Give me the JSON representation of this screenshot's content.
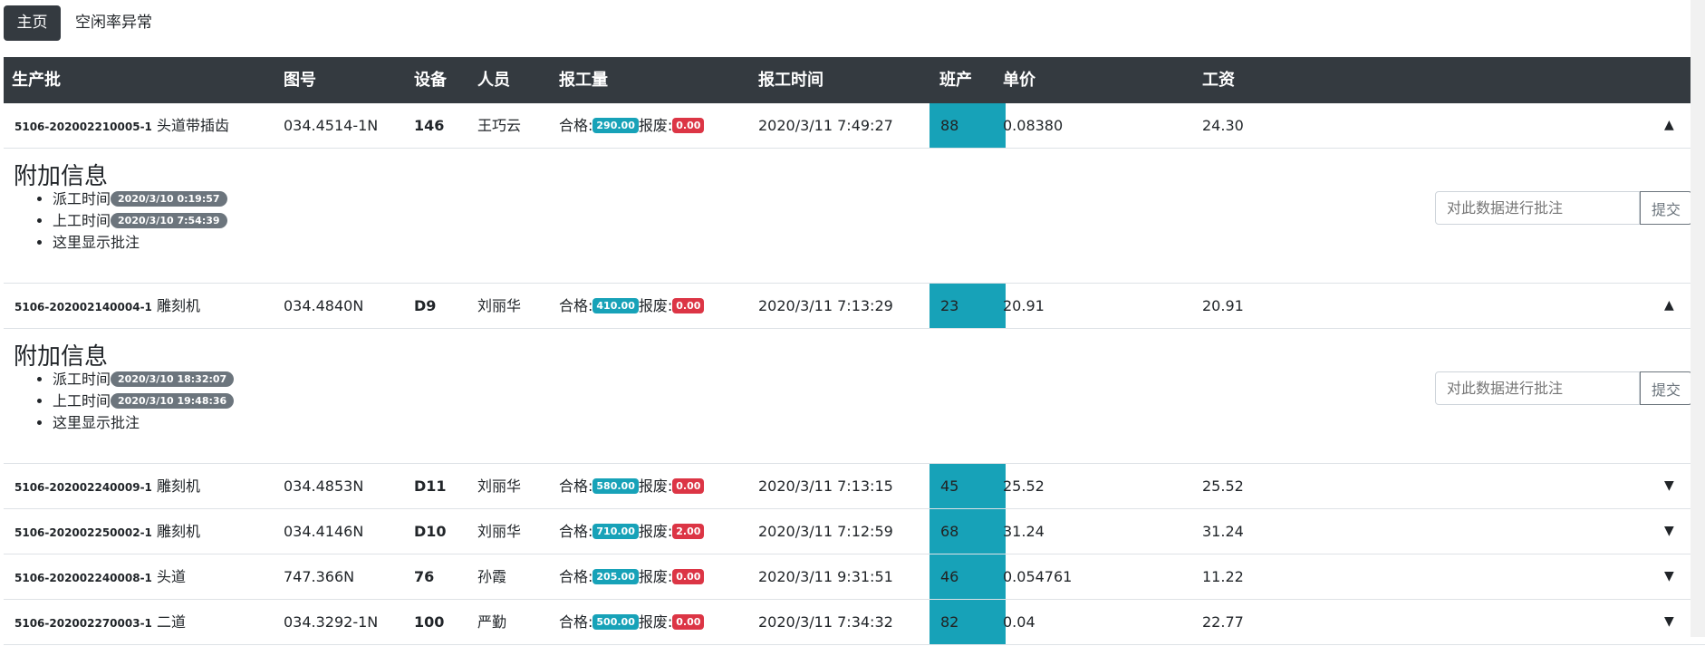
{
  "nav": {
    "home": "主页",
    "idle": "空闲率异常"
  },
  "headers": [
    "生产批",
    "图号",
    "设备",
    "人员",
    "报工量",
    "报工时间",
    "班产",
    "单价",
    "工资"
  ],
  "labels": {
    "qualified": "合格:",
    "scrap": "报废:",
    "detail_title": "附加信息",
    "dispatch_time": "派工时间",
    "start_time": "上工时间",
    "note": "这里显示批注",
    "comment_placeholder": "对此数据进行批注",
    "submit": "提交"
  },
  "rows": [
    {
      "batch": "5106-202002210005-1",
      "process": "头道带插齿",
      "drawing": "034.4514-1N",
      "device": "146",
      "person": "王巧云",
      "qualified": "290.00",
      "scrap": "0.00",
      "time": "2020/3/11 7:49:27",
      "shift": "88",
      "price": "0.08380",
      "wage": "24.30",
      "expanded": true,
      "dispatch": "2020/3/10 0:19:57",
      "start": "2020/3/10 7:54:39"
    },
    {
      "batch": "5106-202002140004-1",
      "process": "雕刻机",
      "drawing": "034.4840N",
      "device": "D9",
      "person": "刘丽华",
      "qualified": "410.00",
      "scrap": "0.00",
      "time": "2020/3/11 7:13:29",
      "shift": "23",
      "price": "20.91",
      "wage": "20.91",
      "expanded": true,
      "dispatch": "2020/3/10 18:32:07",
      "start": "2020/3/10 19:48:36"
    },
    {
      "batch": "5106-202002240009-1",
      "process": "雕刻机",
      "drawing": "034.4853N",
      "device": "D11",
      "person": "刘丽华",
      "qualified": "580.00",
      "scrap": "0.00",
      "time": "2020/3/11 7:13:15",
      "shift": "45",
      "price": "25.52",
      "wage": "25.52",
      "expanded": false
    },
    {
      "batch": "5106-202002250002-1",
      "process": "雕刻机",
      "drawing": "034.4146N",
      "device": "D10",
      "person": "刘丽华",
      "qualified": "710.00",
      "scrap": "2.00",
      "time": "2020/3/11 7:12:59",
      "shift": "68",
      "price": "31.24",
      "wage": "31.24",
      "expanded": false
    },
    {
      "batch": "5106-202002240008-1",
      "process": "头道",
      "drawing": "747.366N",
      "device": "76",
      "person": "孙霞",
      "qualified": "205.00",
      "scrap": "0.00",
      "time": "2020/3/11 9:31:51",
      "shift": "46",
      "price": "0.054761",
      "wage": "11.22",
      "expanded": false
    },
    {
      "batch": "5106-202002270003-1",
      "process": "二道",
      "drawing": "034.3292-1N",
      "device": "100",
      "person": "严勤",
      "qualified": "500.00",
      "scrap": "0.00",
      "time": "2020/3/11 7:34:32",
      "shift": "82",
      "price": "0.04",
      "wage": "22.77",
      "expanded": false
    }
  ],
  "icons": {
    "expanded": "caret-up-icon",
    "collapsed": "caret-down-icon"
  }
}
